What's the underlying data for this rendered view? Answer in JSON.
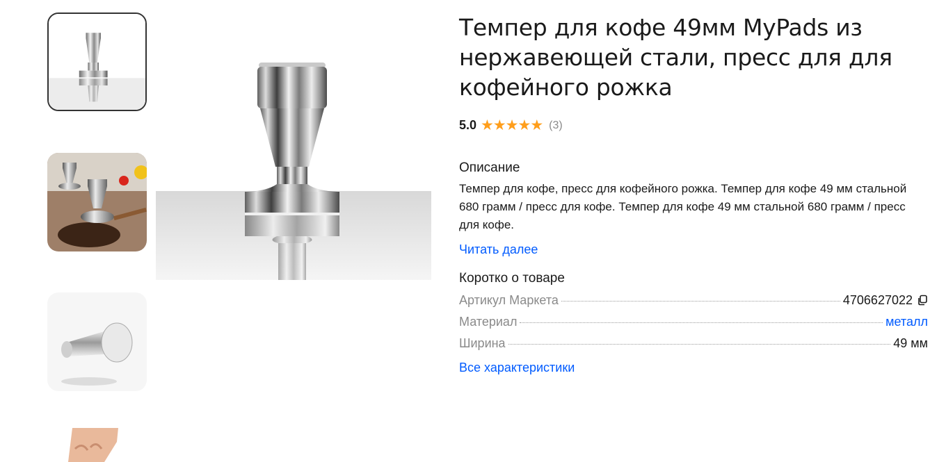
{
  "gallery": {
    "thumbnails": [
      {
        "name": "thumb-tamper-front",
        "selected": true
      },
      {
        "name": "thumb-tamper-coffee-scene",
        "selected": false
      },
      {
        "name": "thumb-tamper-side",
        "selected": false
      },
      {
        "name": "thumb-tamper-hand",
        "selected": false
      }
    ]
  },
  "product": {
    "title": "Темпер для кофе 49мм MyPads из нержавеющей стали, пресс для для кофейного рожка",
    "rating": "5.0",
    "stars": "★★★★★",
    "reviews": "(3)",
    "description_heading": "Описание",
    "description": "Темпер для кофе, пресс для кофейного рожка. Темпер для кофе 49 мм стальной 680 грамм / пресс для кофе. Темпер для кофе 49 мм стальной 680 грамм / пресс для кофе.",
    "read_more": "Читать далее",
    "short_heading": "Коротко о товаре",
    "specs": [
      {
        "name": "Артикул Маркета",
        "value": "4706627022"
      },
      {
        "name": "Материал",
        "value": "металл"
      },
      {
        "name": "Ширина",
        "value": "49 мм"
      }
    ],
    "all_specs": "Все характеристики"
  },
  "colors": {
    "accent": "#005bff",
    "star": "#ff9e1b",
    "muted": "#8a8a8a"
  }
}
